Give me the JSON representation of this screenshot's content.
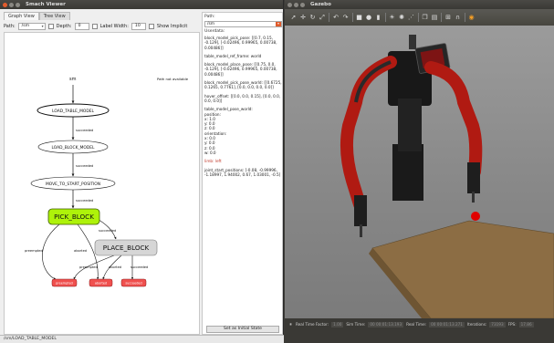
{
  "smach": {
    "title": "Smach Viewer",
    "tabs": [
      "Graph View",
      "Tree View"
    ],
    "toolbar": {
      "path_label": "Path:",
      "path_value": "/sm",
      "depth_label": "Depth:",
      "depth_value": "0",
      "label_width_label": "Label Width:",
      "label_width_value": "10",
      "show_implicit_label": "Show Implicit"
    },
    "graph": {
      "root": "sm",
      "path_not_available": "Path not available",
      "states": [
        "LOAD_TABLE_MODEL",
        "LOAD_BLOCK_MODEL",
        "MOVE_TO_START_POSITION",
        "PICK_BLOCK",
        "PLACE_BLOCK"
      ],
      "edges": [
        "succeeded",
        "succeeded",
        "succeeded",
        "succeeded",
        "preempted",
        "aborted",
        "preempted",
        "aborted",
        "succeeded"
      ],
      "outcomes": [
        "preempted",
        "aborted",
        "succeeded"
      ]
    },
    "pane": {
      "path_label": "Path:",
      "path_value": "/sm",
      "userdata_label": "Userdata:",
      "entries": [
        "block_model_pick_pose: [[0.7, 0.15, -0.129], [-0.02496, 0.99965, 0.00738, 0.00486]]",
        "table_model_ref_frame: world",
        "block_model_place_pose: [[0.75, 0.0, -0.129], [-0.02496, 0.99965, 0.00738, 0.00486]]",
        "block_model_pick_pose_world: [[0.6725, 0.1265, 0.7761], [0.0, 0.0, 0.0, 0.0]]",
        "hover_offset: [[0.0, 0.0, 0.15], [0.0, 0.0, 0.0, 0.0]]",
        "table_model_pose_world:\nposition:\n  x: 1.0\n  y: 0.0\n  z: 0.0\norientation:\n  x: 0.0\n  y: 0.0\n  z: 0.0\n  w: 0.0",
        "limb: left",
        "joint_start_positions: [-0.08, -0.99996, -1.18997, 1.94002, 0.67, 1.03001, -0.5]"
      ],
      "set_initial_state": "Set as Initial State"
    },
    "statusbar": "/sm/LOAD_TABLE_MODEL"
  },
  "gazebo": {
    "title": "Gazebo",
    "status": {
      "real_time_factor_label": "Real Time Factor:",
      "real_time_factor_value": "1.00",
      "sim_time_label": "Sim Time:",
      "sim_time_value": "00 00:01:13.193",
      "real_time_label": "Real Time:",
      "real_time_value": "00 00:01:13.271",
      "iterations_label": "Iterations:",
      "iterations_value": "73193",
      "fps_label": "FPS:",
      "fps_value": "17.86"
    }
  },
  "colors": {
    "pick_block_fill": "#aef20a",
    "place_block_fill": "#d6d6d6",
    "outcome_fill": "#f0504e",
    "baxter_red": "#b01a12",
    "table_top": "#8c6d44",
    "gazebo_toolbar": "#4f4e49",
    "accent": "#e05a2a"
  },
  "icons": [
    "close-icon",
    "arrow-select-icon",
    "move-icon",
    "rotate-icon",
    "scale-icon",
    "undo-icon",
    "redo-icon",
    "box-icon",
    "sphere-icon",
    "cylinder-icon",
    "sun-icon",
    "point-light-icon",
    "spot-light-icon",
    "copy-icon",
    "paste-icon",
    "align-icon",
    "snap-icon",
    "camera-icon",
    "record-icon",
    "pause-icon"
  ]
}
